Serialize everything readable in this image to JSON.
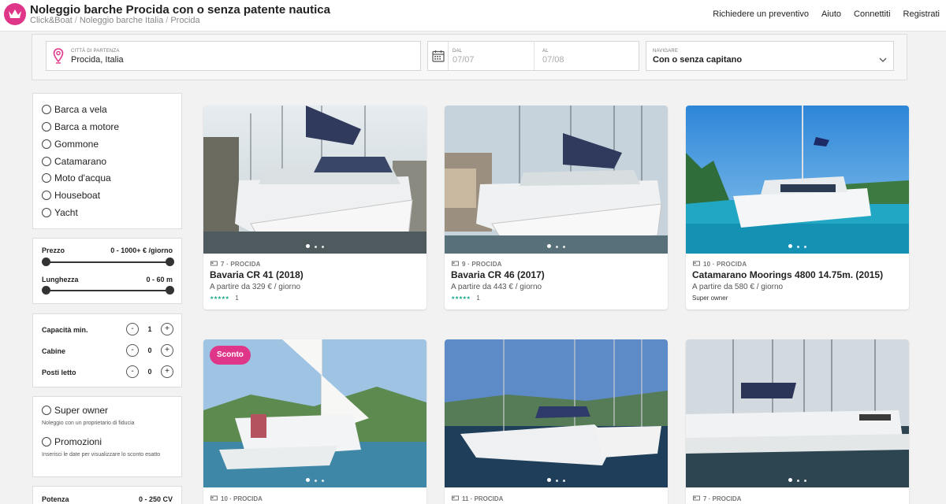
{
  "header": {
    "title": "Noleggio barche Procida con o senza patente nautica",
    "breadcrumb": [
      "Click&Boat",
      "Noleggio barche Italia",
      "Procida"
    ],
    "nav": [
      "Richiedere un preventivo",
      "Aiuto",
      "Connettiti",
      "Registrati"
    ],
    "brand_color": "#e0368a"
  },
  "search": {
    "city_label": "Città di partenza",
    "city_value": "Procida, Italia",
    "from_label": "Dal",
    "from_value": "07/07",
    "to_label": "Al",
    "to_value": "07/08",
    "nav_label": "Navigare",
    "nav_value": "Con o senza capitano"
  },
  "sidebar": {
    "boat_types": [
      "Barca a vela",
      "Barca a motore",
      "Gommone",
      "Catamarano",
      "Moto d'acqua",
      "Houseboat",
      "Yacht"
    ],
    "price_label": "Prezzo",
    "price_value": "0 - 1000+ € /giorno",
    "length_label": "Lunghezza",
    "length_value": "0 - 60 m",
    "capacity_label": "Capacità min.",
    "capacity_value": "1",
    "cabins_label": "Cabine",
    "cabins_value": "0",
    "berths_label": "Posti letto",
    "berths_value": "0",
    "minus": "-",
    "plus": "+",
    "superowner_title": "Super owner",
    "superowner_sub": "Noleggio con un proprietario di fiducia",
    "promo_title": "Promozioni",
    "promo_sub": "Inserisci le date per visualizzare lo sconto esatto",
    "power_label": "Potenza",
    "power_value": "0 - 250 CV"
  },
  "listings": [
    {
      "meta": "7 · PROCIDA",
      "name": "Bavaria CR 41  (2018)",
      "price": "A partire da 329 € / giorno",
      "stars": "★★★★★",
      "reviews": "1"
    },
    {
      "meta": "9 · PROCIDA",
      "name": "Bavaria CR 46  (2017)",
      "price": "A partire da 443 € / giorno",
      "stars": "★★★★★",
      "reviews": "1"
    },
    {
      "meta": "10 · PROCIDA",
      "name": "Catamarano Moorings 4800 14.75m.  (2015)",
      "price": "A partire da 580 € / giorno",
      "tag": "Super owner"
    },
    {
      "meta": "10 · PROCIDA",
      "badge": "Sconto"
    },
    {
      "meta": "11 · PROCIDA"
    },
    {
      "meta": "7 · PROCIDA"
    }
  ]
}
